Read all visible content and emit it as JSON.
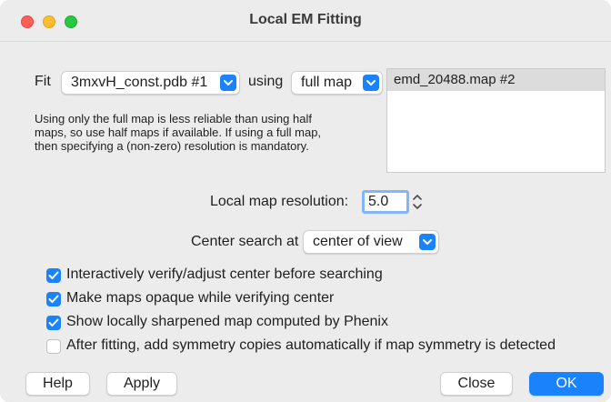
{
  "window": {
    "title": "Local EM Fitting"
  },
  "fit": {
    "label": "Fit",
    "model_selected": "3mxvH_const.pdb #1",
    "using_label": "using",
    "map_mode_selected": "full map"
  },
  "map_list": {
    "items": [
      "emd_20488.map #2"
    ]
  },
  "note": "Using only the full map is less reliable than using half\nmaps, so use half maps if available.  If using a full map,\nthen specifying a (non-zero) resolution is mandatory.",
  "resolution": {
    "label": "Local map resolution:",
    "value": "5.0"
  },
  "center": {
    "label": "Center search at",
    "selected": "center of view"
  },
  "options": [
    {
      "label": "Interactively verify/adjust center before searching",
      "checked": true
    },
    {
      "label": "Make maps opaque while verifying center",
      "checked": true
    },
    {
      "label": "Show locally sharpened map computed by Phenix",
      "checked": true
    },
    {
      "label": "After fitting, add symmetry copies automatically if map symmetry is detected",
      "checked": false
    }
  ],
  "buttons": {
    "help": "Help",
    "apply": "Apply",
    "close": "Close",
    "ok": "OK"
  },
  "colors": {
    "accent": "#1a82fb",
    "close_light": "#ff5f57",
    "minimize_light": "#febc2e",
    "zoom_light": "#28c840"
  }
}
